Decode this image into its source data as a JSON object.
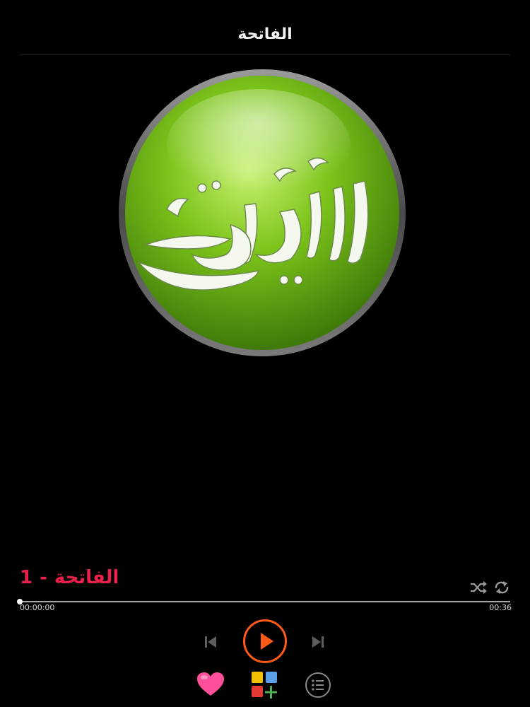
{
  "header": {
    "title": "الفاتحة"
  },
  "artwork": {
    "calligraphy_text": "القرآن الكريم",
    "colors": {
      "ring": "#5a5a5a",
      "green_light": "#c8f070",
      "green_mid": "#7cc41a",
      "green_dark": "#3f7a0a",
      "letter_fill": "#f4f8ee"
    }
  },
  "player": {
    "track_number": "1",
    "track_separator": "-",
    "track_name": "الفاتحة",
    "current_time": "00:00:00",
    "total_time": "00:36",
    "progress": 0.0
  },
  "controls": {
    "previous": "skip-previous-icon",
    "play": "play-icon",
    "next": "skip-next-icon",
    "shuffle": "shuffle-icon",
    "repeat": "repeat-icon",
    "favorite": "heart-icon",
    "categories": "grid-plus-icon",
    "playlist": "list-icon"
  },
  "colors": {
    "background": "#000000",
    "accent": "#ff5a17",
    "track_title": "#e8204a",
    "heart": "#ff4f9a",
    "muted_icon": "#8a8a8a"
  }
}
